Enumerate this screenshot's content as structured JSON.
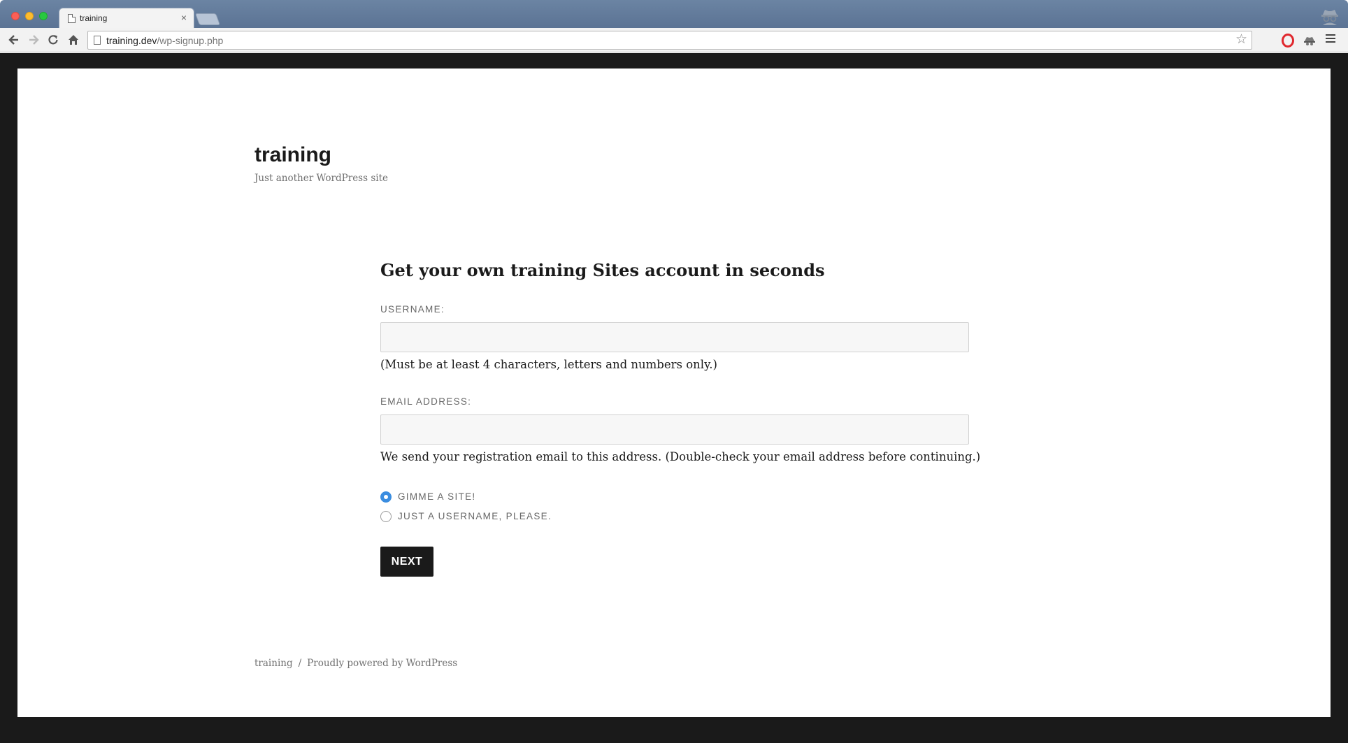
{
  "browser": {
    "tab": {
      "title": "training",
      "close_glyph": "×"
    },
    "url": {
      "domain": "training.dev",
      "path": "/wp-signup.php"
    },
    "icons": [
      "back-icon",
      "forward-icon",
      "reload-icon",
      "home-icon",
      "bookmark-star-icon",
      "opera-extension-icon",
      "spy-extension-icon",
      "menu-icon",
      "incognito-profile-icon"
    ]
  },
  "site": {
    "title": "training",
    "tagline": "Just another WordPress site"
  },
  "signup": {
    "heading": "Get your own training Sites account in seconds",
    "username": {
      "label": "Username:",
      "value": "",
      "help": "(Must be at least 4 characters, letters and numbers only.)"
    },
    "email": {
      "label": "Email Address:",
      "value": "",
      "help": "We send your registration email to this address. (Double-check your email address before continuing.)"
    },
    "options": [
      {
        "label": "Gimme a site!",
        "selected": true
      },
      {
        "label": "Just a username, please.",
        "selected": false
      }
    ],
    "submit_label": "Next"
  },
  "footer": {
    "site_link": "training",
    "separator": "/",
    "powered_by": "Proudly powered by WordPress"
  },
  "colors": {
    "accent": "#3b8de0",
    "button_bg": "#1a1a1a",
    "frame": "#1a1a1a",
    "chrome": "#5b7394"
  }
}
